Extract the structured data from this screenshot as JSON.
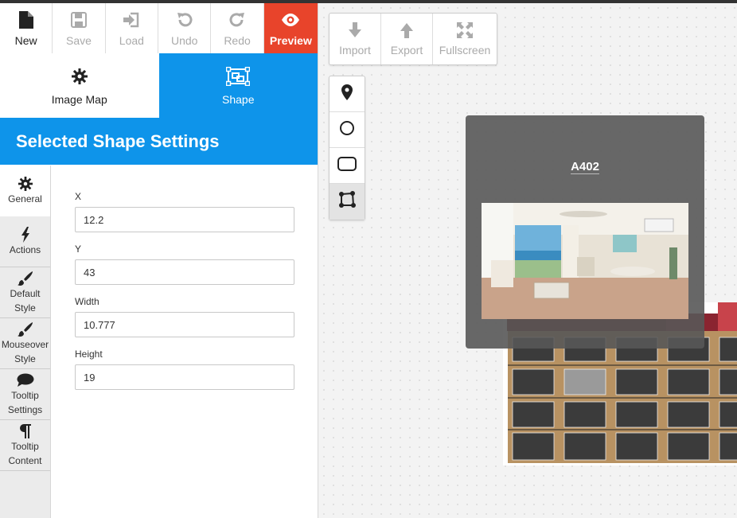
{
  "toolbar": {
    "new": "New",
    "save": "Save",
    "load": "Load",
    "undo": "Undo",
    "redo": "Redo",
    "preview": "Preview"
  },
  "modes": {
    "image_map": "Image Map",
    "shape": "Shape"
  },
  "section_title": "Selected Shape Settings",
  "side_tabs": {
    "general": "General",
    "actions": "Actions",
    "default_style_1": "Default",
    "default_style_2": "Style",
    "mouseover_style_1": "Mouseover",
    "mouseover_style_2": "Style",
    "tooltip_settings_1": "Tooltip",
    "tooltip_settings_2": "Settings",
    "tooltip_content_1": "Tooltip",
    "tooltip_content_2": "Content"
  },
  "fields": {
    "x_label": "X",
    "x_value": "12.2",
    "y_label": "Y",
    "y_value": "43",
    "width_label": "Width",
    "width_value": "10.777",
    "height_label": "Height",
    "height_value": "19"
  },
  "canvas_tools": {
    "import": "Import",
    "export": "Export",
    "fullscreen": "Fullscreen"
  },
  "tooltip": {
    "title": "A402"
  },
  "colors": {
    "accent_blue": "#0e94ea",
    "preview_red": "#e8442b"
  }
}
